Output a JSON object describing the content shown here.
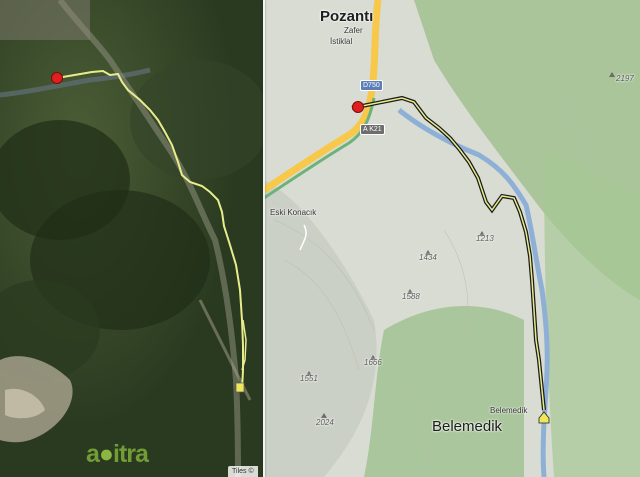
{
  "map": {
    "place_labels": {
      "pozanti": "Pozantı",
      "zafer": "Zafer",
      "istiklal": "İstiklal",
      "eski_konacik": "Eski Konacık",
      "belemedik_small": "Belemedik",
      "belemedik_big": "Belemedik"
    },
    "road_shields": {
      "d750": "D750",
      "k21": "A K21"
    },
    "peaks": [
      "2197",
      "1213",
      "1434",
      "1588",
      "1666",
      "1551",
      "2024"
    ],
    "attribution": "Tiles ©",
    "logo": {
      "text_a": "a",
      "text_b": "itra"
    },
    "colors": {
      "track": "#e9ec8c",
      "track_topo": "#1b1b1b",
      "start_marker": "#e0201e",
      "river": "#8fb0d6",
      "highway": "#f7c84a"
    },
    "icons": {
      "start": "start-marker-icon",
      "finish": "finish-home-icon"
    }
  }
}
